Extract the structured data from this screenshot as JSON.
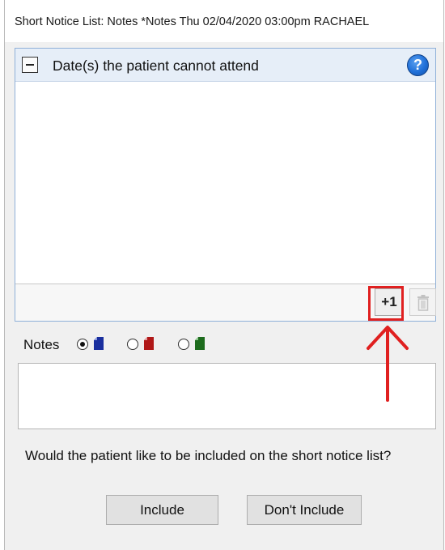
{
  "window": {
    "title": "Short Notice List: Notes *Notes Thu 02/04/2020 03:00pm RACHAEL"
  },
  "dates_panel": {
    "title": "Date(s) the patient cannot attend",
    "add_label": "+1",
    "help_glyph": "?",
    "icons": [
      "minus-icon",
      "help-icon",
      "trash-icon"
    ]
  },
  "notes": {
    "label": "Notes",
    "options": [
      {
        "color": "#1a2f9e",
        "selected": true
      },
      {
        "color": "#b01818",
        "selected": false
      },
      {
        "color": "#1d6b1d",
        "selected": false
      }
    ],
    "value": ""
  },
  "prompt": {
    "question": "Would the patient like to be included on the short notice list?",
    "include_label": "Include",
    "dont_include_label": "Don't Include"
  },
  "annotation": {
    "color": "#e02020"
  }
}
